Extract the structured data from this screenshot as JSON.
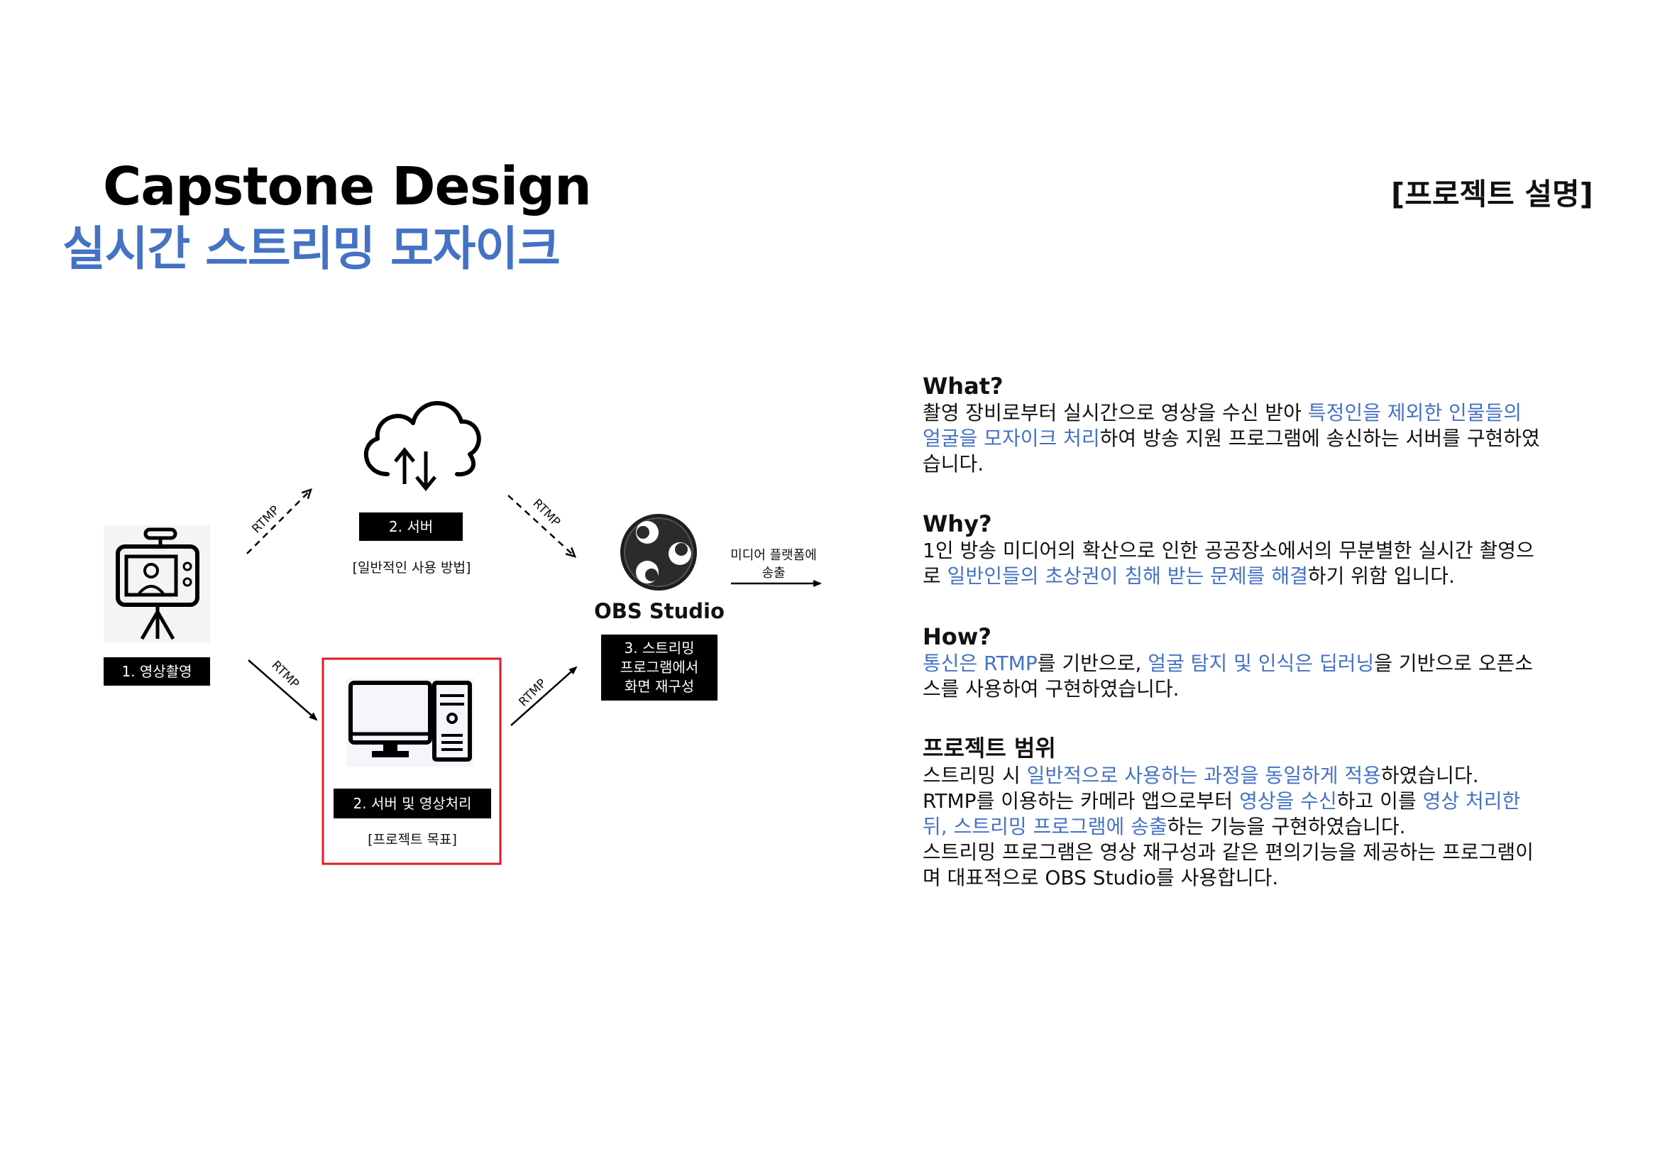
{
  "header": {
    "title_en": "Capstone Design",
    "title_ko": "실시간 스트리밍 모자이크",
    "section_tag": "[프로젝트 설명]"
  },
  "diagram": {
    "node_camera": {
      "label": "1. 영상촬영"
    },
    "node_server": {
      "label": "2. 서버",
      "caption": "[일반적인 사용 방법]"
    },
    "node_processing": {
      "label": "2. 서버 및 영상처리",
      "caption": "[프로젝트 목표]"
    },
    "node_obs": {
      "name": "OBS Studio",
      "label_lines": [
        "3. 스트리밍",
        "프로그램에서",
        "화면 재구성"
      ]
    },
    "edge_label": "RTMP",
    "output_label_lines": [
      "미디어 플랫폼에",
      "송출"
    ],
    "highlight_color": "#e01b24"
  },
  "description": {
    "accent_color": "#4472c4",
    "what": {
      "heading": "What?",
      "p1": " 촬영 장비로부터 실시간으로 영상을 수신 받아 ",
      "h1": "특정인을 제외한 인물들의 얼굴을 모자이크 처리",
      "p2": "하여 방송 지원 프로그램에 송신하는 서버를 구현하였습니다."
    },
    "why": {
      "heading": "Why?",
      "p1": " 1인 방송 미디어의 확산으로 인한 공공장소에서의 무분별한 실시간 촬영으로 ",
      "h1": "일반인들의 초상권이 침해 받는 문제를 해결",
      "p2": "하기 위함 입니다."
    },
    "how": {
      "heading": "How?",
      "p0": " ",
      "h1": "통신은 RTMP",
      "p1": "를 기반으로, ",
      "h2": "얼굴 탐지 및 인식은 딥러닝",
      "p2": "을 기반으로 오픈소스를 사용하여 구현하였습니다."
    },
    "scope": {
      "heading": "프로젝트 범위",
      "p0": " 스트리밍 시 ",
      "h1": "일반적으로 사용하는 과정을 동일하게 적용",
      "p1": "하였습니다.",
      "p2": "RTMP를 이용하는 카메라 앱으로부터 ",
      "h2": "영상을 수신",
      "p3": "하고 이를 ",
      "h3": "영상 처리한 뒤, 스트리밍 프로그램에 송출",
      "p4": "하는 기능을 구현하였습니다.",
      "p5": " 스트리밍 프로그램은 영상 재구성과 같은 편의기능을 제공하는 프로그램이며 대표적으로 OBS Studio를 사용합니다."
    }
  }
}
